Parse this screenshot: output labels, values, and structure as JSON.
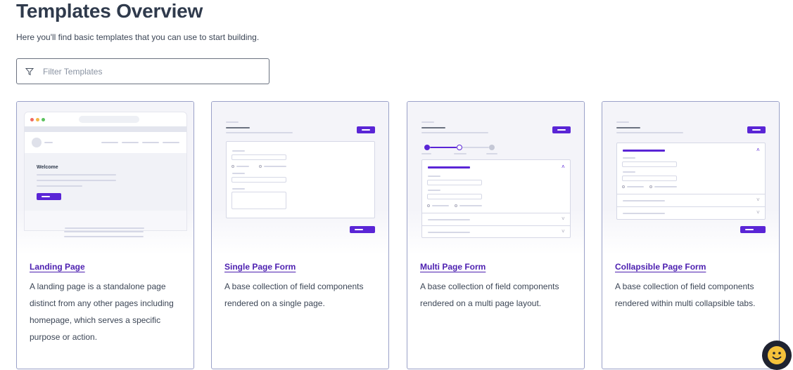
{
  "header": {
    "title": "Templates Overview",
    "subtitle": "Here you'll find basic templates that you can use to start building."
  },
  "filter": {
    "icon": "filter-icon",
    "placeholder": "Filter Templates",
    "value": ""
  },
  "preview": {
    "welcome": "Welcome"
  },
  "templates": [
    {
      "title": "Landing Page",
      "description": "A landing page is a standalone page distinct from any other pages including homepage, which serves a specific purpose or action."
    },
    {
      "title": "Single Page Form",
      "description": "A base collection of field components rendered on a single page."
    },
    {
      "title": "Multi Page Form",
      "description": "A base collection of field components rendered on a multi page layout."
    },
    {
      "title": "Collapsible Page Form",
      "description": "A base collection of field components rendered within multi collapsible tabs."
    }
  ],
  "colors": {
    "accent": "#5a25d6",
    "link": "#4c1fb0",
    "card_border": "#9aa1c8",
    "helper_bg": "#1f2330",
    "helper_face": "#f5c23b"
  },
  "helper": {
    "icon": "smiley-face-icon"
  }
}
